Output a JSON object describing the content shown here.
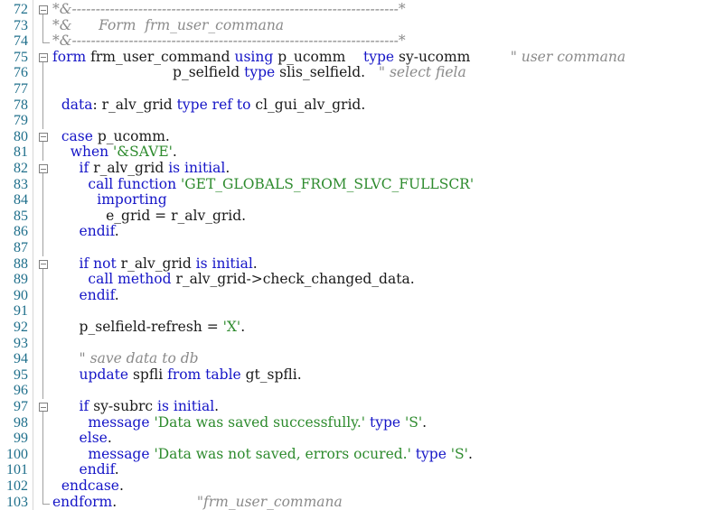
{
  "editor": {
    "colors": {
      "keyword": "#1515c7",
      "identifier": "#1a1a1a",
      "string": "#2e8b2e",
      "comment": "#8a8a8a",
      "line_number": "#1f6f8b"
    },
    "lines": [
      {
        "num": "72",
        "fold": "box",
        "tokens": [
          {
            "t": "*&---------------------------------------------------------------------*",
            "c": "com"
          }
        ]
      },
      {
        "num": "73",
        "fold": "line",
        "tokens": [
          {
            "t": "*&      Form  frm_user_commana",
            "c": "com"
          }
        ]
      },
      {
        "num": "74",
        "fold": "end",
        "tokens": [
          {
            "t": "*&---------------------------------------------------------------------*",
            "c": "com"
          }
        ]
      },
      {
        "num": "75",
        "fold": "box",
        "tokens": [
          {
            "t": "form",
            "c": "kw"
          },
          {
            "t": " frm_user_command ",
            "c": "id"
          },
          {
            "t": "using",
            "c": "kw"
          },
          {
            "t": " p_ucomm    ",
            "c": "id"
          },
          {
            "t": "type",
            "c": "kw"
          },
          {
            "t": " sy-ucomm         ",
            "c": "id"
          },
          {
            "t": "\" user commana",
            "c": "com"
          }
        ]
      },
      {
        "num": "76",
        "fold": "line",
        "tokens": [
          {
            "t": "                           p_selfield ",
            "c": "id"
          },
          {
            "t": "type",
            "c": "kw"
          },
          {
            "t": " slis_selfield.   ",
            "c": "id"
          },
          {
            "t": "\" select fiela",
            "c": "com"
          }
        ]
      },
      {
        "num": "77",
        "fold": "line",
        "tokens": []
      },
      {
        "num": "78",
        "fold": "line",
        "tokens": [
          {
            "t": "  data",
            "c": "kw"
          },
          {
            "t": ": r_alv_grid ",
            "c": "id"
          },
          {
            "t": "type ref to",
            "c": "kw"
          },
          {
            "t": " cl_gui_alv_grid.",
            "c": "id"
          }
        ]
      },
      {
        "num": "79",
        "fold": "line",
        "tokens": []
      },
      {
        "num": "80",
        "fold": "box",
        "tokens": [
          {
            "t": "  case",
            "c": "kw"
          },
          {
            "t": " p_ucomm.",
            "c": "id"
          }
        ]
      },
      {
        "num": "81",
        "fold": "line",
        "tokens": [
          {
            "t": "    when ",
            "c": "kw"
          },
          {
            "t": "'&SAVE'",
            "c": "str"
          },
          {
            "t": ".",
            "c": "id"
          }
        ]
      },
      {
        "num": "82",
        "fold": "box",
        "tokens": [
          {
            "t": "      if",
            "c": "kw"
          },
          {
            "t": " r_alv_grid ",
            "c": "id"
          },
          {
            "t": "is initial",
            "c": "kw"
          },
          {
            "t": ".",
            "c": "id"
          }
        ]
      },
      {
        "num": "83",
        "fold": "line",
        "tokens": [
          {
            "t": "        call function ",
            "c": "kw"
          },
          {
            "t": "'GET_GLOBALS_FROM_SLVC_FULLSCR'",
            "c": "str"
          }
        ]
      },
      {
        "num": "84",
        "fold": "line",
        "tokens": [
          {
            "t": "          importing",
            "c": "kw"
          }
        ]
      },
      {
        "num": "85",
        "fold": "line",
        "tokens": [
          {
            "t": "            e_grid = r_alv_grid.",
            "c": "id"
          }
        ]
      },
      {
        "num": "86",
        "fold": "line",
        "tokens": [
          {
            "t": "      endif",
            "c": "kw"
          },
          {
            "t": ".",
            "c": "id"
          }
        ]
      },
      {
        "num": "87",
        "fold": "line",
        "tokens": []
      },
      {
        "num": "88",
        "fold": "box",
        "tokens": [
          {
            "t": "      if not",
            "c": "kw"
          },
          {
            "t": " r_alv_grid ",
            "c": "id"
          },
          {
            "t": "is initial",
            "c": "kw"
          },
          {
            "t": ".",
            "c": "id"
          }
        ]
      },
      {
        "num": "89",
        "fold": "line",
        "tokens": [
          {
            "t": "        call method",
            "c": "kw"
          },
          {
            "t": " r_alv_grid->check_changed_data.",
            "c": "id"
          }
        ]
      },
      {
        "num": "90",
        "fold": "line",
        "tokens": [
          {
            "t": "      endif",
            "c": "kw"
          },
          {
            "t": ".",
            "c": "id"
          }
        ]
      },
      {
        "num": "91",
        "fold": "line",
        "tokens": []
      },
      {
        "num": "92",
        "fold": "line",
        "tokens": [
          {
            "t": "      p_selfield-refresh = ",
            "c": "id"
          },
          {
            "t": "'X'",
            "c": "str"
          },
          {
            "t": ".",
            "c": "id"
          }
        ]
      },
      {
        "num": "93",
        "fold": "line",
        "tokens": []
      },
      {
        "num": "94",
        "fold": "line",
        "tokens": [
          {
            "t": "      \" save data to db",
            "c": "com"
          }
        ]
      },
      {
        "num": "95",
        "fold": "line",
        "tokens": [
          {
            "t": "      update",
            "c": "kw"
          },
          {
            "t": " spfli ",
            "c": "id"
          },
          {
            "t": "from table",
            "c": "kw"
          },
          {
            "t": " gt_spfli.",
            "c": "id"
          }
        ]
      },
      {
        "num": "96",
        "fold": "line",
        "tokens": []
      },
      {
        "num": "97",
        "fold": "box",
        "tokens": [
          {
            "t": "      if",
            "c": "kw"
          },
          {
            "t": " sy-subrc ",
            "c": "id"
          },
          {
            "t": "is initial",
            "c": "kw"
          },
          {
            "t": ".",
            "c": "id"
          }
        ]
      },
      {
        "num": "98",
        "fold": "line",
        "tokens": [
          {
            "t": "        message ",
            "c": "kw"
          },
          {
            "t": "'Data was saved successfully.'",
            "c": "str"
          },
          {
            "t": " type ",
            "c": "kw"
          },
          {
            "t": "'S'",
            "c": "str"
          },
          {
            "t": ".",
            "c": "id"
          }
        ]
      },
      {
        "num": "99",
        "fold": "line",
        "tokens": [
          {
            "t": "      else",
            "c": "kw"
          },
          {
            "t": ".",
            "c": "id"
          }
        ]
      },
      {
        "num": "100",
        "fold": "line",
        "tokens": [
          {
            "t": "        message ",
            "c": "kw"
          },
          {
            "t": "'Data was not saved, errors ocured.'",
            "c": "str"
          },
          {
            "t": " type ",
            "c": "kw"
          },
          {
            "t": "'S'",
            "c": "str"
          },
          {
            "t": ".",
            "c": "id"
          }
        ]
      },
      {
        "num": "101",
        "fold": "line",
        "tokens": [
          {
            "t": "      endif",
            "c": "kw"
          },
          {
            "t": ".",
            "c": "id"
          }
        ]
      },
      {
        "num": "102",
        "fold": "line",
        "tokens": [
          {
            "t": "  endcase",
            "c": "kw"
          },
          {
            "t": ".",
            "c": "id"
          }
        ]
      },
      {
        "num": "103",
        "fold": "end",
        "tokens": [
          {
            "t": "endform",
            "c": "kw"
          },
          {
            "t": ".                  ",
            "c": "id"
          },
          {
            "t": "\"frm_user_commana",
            "c": "com"
          }
        ]
      }
    ]
  }
}
